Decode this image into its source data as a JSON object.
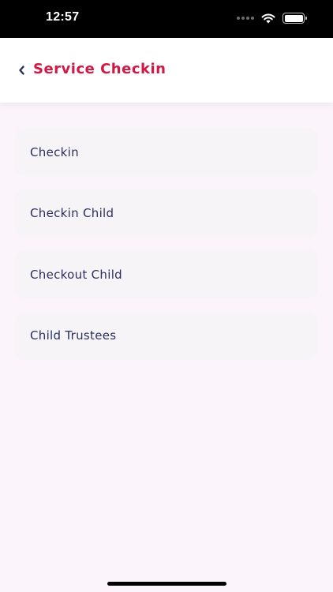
{
  "status_bar": {
    "time": "12:57"
  },
  "header": {
    "title": "Service Checkin",
    "back_icon": "chevron-left-icon"
  },
  "menu": {
    "items": [
      {
        "label": "Checkin"
      },
      {
        "label": "Checkin Child"
      },
      {
        "label": "Checkout Child"
      },
      {
        "label": "Child Trustees"
      }
    ]
  },
  "colors": {
    "accent": "#d31845",
    "item_text": "#2b2f62",
    "item_background": "#f6f4f6",
    "page_background": "#fbf5fb",
    "back_icon": "#2b2f62"
  }
}
